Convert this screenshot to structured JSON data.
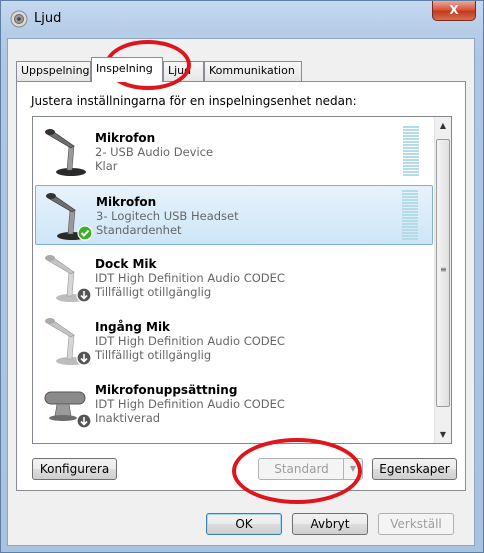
{
  "window": {
    "title": "Ljud",
    "close_label": "X"
  },
  "tabs": [
    {
      "label": "Uppspelning",
      "active": false
    },
    {
      "label": "Inspelning",
      "active": true
    },
    {
      "label": "Ljud",
      "active": false
    },
    {
      "label": "Kommunikation",
      "active": false
    }
  ],
  "instruction": "Justera inställningarna för en inspelningsenhet nedan:",
  "devices": [
    {
      "name": "Mikrofon",
      "line2": "2- USB Audio Device",
      "status": "Klar",
      "icon": "microphone-icon",
      "selected": false
    },
    {
      "name": "Mikrofon",
      "line2": "3- Logitech USB Headset",
      "status": "Standardenhet",
      "icon": "microphone-default-icon",
      "selected": true
    },
    {
      "name": "Dock Mik",
      "line2": "IDT High Definition Audio CODEC",
      "status": "Tillfälligt otillgänglig",
      "icon": "microphone-disabled-icon",
      "selected": false
    },
    {
      "name": "Ingång Mik",
      "line2": "IDT High Definition Audio CODEC",
      "status": "Tillfälligt otillgänglig",
      "icon": "microphone-disabled-icon",
      "selected": false
    },
    {
      "name": "Mikrofonuppsättning",
      "line2": "IDT High Definition Audio CODEC",
      "status": "Inaktiverad",
      "icon": "microphone-array-icon",
      "selected": false
    }
  ],
  "buttons": {
    "configure": "Konfigurera",
    "set_default": "Standard",
    "properties": "Egenskaper",
    "ok": "OK",
    "cancel": "Avbryt",
    "apply": "Verkställ"
  },
  "colors": {
    "annotation": "#e0141b",
    "selection": "#cde6f7",
    "default_check": "#3fae2a"
  }
}
